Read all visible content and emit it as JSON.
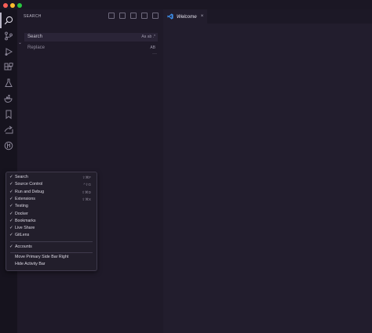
{
  "colors": {
    "close": "#fe5f57",
    "minimize": "#febc2e",
    "zoom": "#28c840",
    "accent": "#3c8ce7"
  },
  "activity_bar": {
    "icons": [
      "search-icon",
      "source-control-icon",
      "run-debug-icon",
      "extensions-icon",
      "testing-icon",
      "docker-icon",
      "bookmark-icon",
      "live-share-icon",
      "gitlens-icon"
    ]
  },
  "sidebar": {
    "title": "SEARCH",
    "search": {
      "placeholder": "Search",
      "options": "Aa  ab  .*"
    },
    "replace": {
      "placeholder": "Replace",
      "options": "AB"
    }
  },
  "editor": {
    "tab": {
      "label": "Welcome",
      "close": "×"
    }
  },
  "context_menu": {
    "items": [
      {
        "check": "✓",
        "label": "Search",
        "shortcut": "⇧⌘F"
      },
      {
        "check": "✓",
        "label": "Source Control",
        "shortcut": "^⇧G"
      },
      {
        "check": "✓",
        "label": "Run and Debug",
        "shortcut": "⇧⌘D"
      },
      {
        "check": "✓",
        "label": "Extensions",
        "shortcut": "⇧⌘X"
      },
      {
        "check": "✓",
        "label": "Testing",
        "shortcut": ""
      },
      {
        "check": "✓",
        "label": "Docker",
        "shortcut": ""
      },
      {
        "check": "✓",
        "label": "Bookmarks",
        "shortcut": ""
      },
      {
        "check": "✓",
        "label": "Live Share",
        "shortcut": ""
      },
      {
        "check": "✓",
        "label": "GitLens",
        "shortcut": ""
      }
    ],
    "accounts": {
      "check": "✓",
      "label": "Accounts"
    },
    "actions": [
      {
        "label": "Move Primary Side Bar Right"
      },
      {
        "label": "Hide Activity Bar"
      }
    ]
  }
}
